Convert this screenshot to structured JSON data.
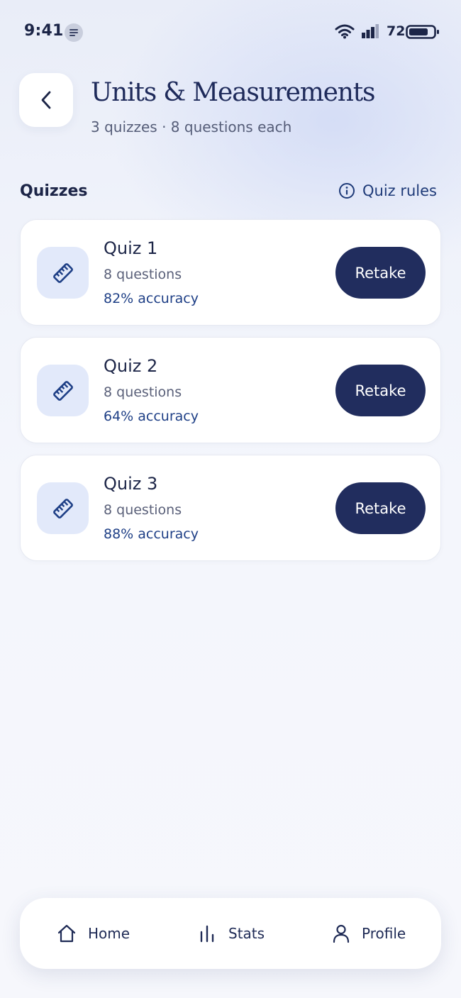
{
  "status_bar": {
    "time": "9:41",
    "battery_level": "72",
    "icons": [
      "notification-icon",
      "wifi-icon",
      "signal-icon",
      "battery-icon"
    ]
  },
  "header": {
    "back_icon": "chevron-left-icon",
    "title": "Units & Measurements",
    "subtitle": "3 quizzes · 8 questions each"
  },
  "section": {
    "title": "Quizzes",
    "rules_label": "Quiz rules",
    "rules_icon": "info-icon"
  },
  "quizzes": [
    {
      "name": "Quiz 1",
      "questions": "8 questions",
      "accuracy": "82% accuracy",
      "action": "Retake",
      "icon": "ruler-icon"
    },
    {
      "name": "Quiz 2",
      "questions": "8 questions",
      "accuracy": "64% accuracy",
      "action": "Retake",
      "icon": "ruler-icon"
    },
    {
      "name": "Quiz 3",
      "questions": "8 questions",
      "accuracy": "88% accuracy",
      "action": "Retake",
      "icon": "ruler-icon"
    }
  ],
  "bottom_nav": {
    "items": [
      {
        "label": "Home",
        "icon": "home-icon"
      },
      {
        "label": "Stats",
        "icon": "bar-chart-icon"
      },
      {
        "label": "Profile",
        "icon": "person-icon"
      }
    ]
  },
  "colors": {
    "primary": "#212d5e",
    "accent_text": "#1e3f86",
    "icon_bg": "#e2e9fa",
    "card_bg": "#ffffff"
  }
}
